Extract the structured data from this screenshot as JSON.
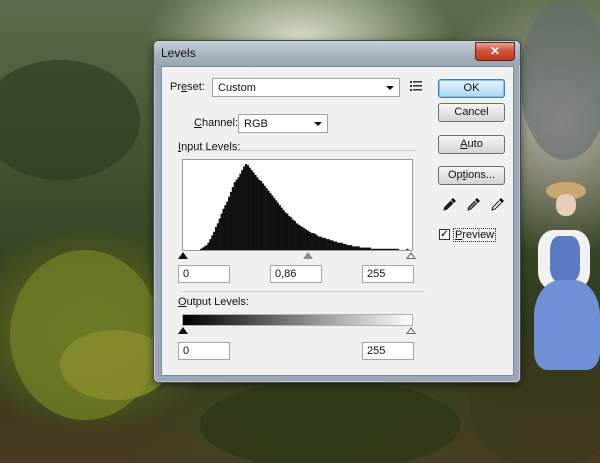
{
  "dialog": {
    "title": "Levels",
    "close_glyph": "✕",
    "preset": {
      "label_pre": "Pr",
      "label_u": "e",
      "label_post": "set:",
      "value": "Custom"
    },
    "channel": {
      "label_u": "C",
      "label_post": "hannel:",
      "value": "RGB"
    },
    "input_levels": {
      "label_u": "I",
      "label_post": "nput Levels:",
      "black": "0",
      "mid": "0,86",
      "white": "255"
    },
    "output_levels": {
      "label_u": "O",
      "label_post": "utput Levels:",
      "black": "0",
      "white": "255"
    },
    "buttons": {
      "ok": "OK",
      "cancel": "Cancel",
      "auto_u": "A",
      "auto_post": "uto",
      "options_pre": "Op",
      "options_u": "t",
      "options_post": "ions..."
    },
    "preview": {
      "label_u": "P",
      "label_post": "review",
      "checked": true,
      "check_glyph": "✓"
    }
  },
  "histogram": {
    "values": [
      0,
      0,
      0,
      0,
      0,
      0,
      0,
      0,
      0,
      1,
      2,
      3,
      4,
      6,
      9,
      12,
      15,
      19,
      22,
      26,
      30,
      34,
      37,
      40,
      44,
      48,
      52,
      56,
      58,
      60,
      63,
      66,
      69,
      71,
      70,
      68,
      66,
      64,
      62,
      60,
      58,
      57,
      55,
      53,
      51,
      49,
      47,
      45,
      43,
      41,
      39,
      37,
      35,
      33,
      31,
      30,
      28,
      27,
      25,
      24,
      22,
      21,
      20,
      19,
      18,
      17,
      16,
      15,
      14,
      14,
      13,
      12,
      11,
      11,
      10,
      10,
      9,
      9,
      8,
      8,
      7,
      7,
      6,
      6,
      6,
      5,
      5,
      4,
      4,
      4,
      3,
      3,
      3,
      3,
      2,
      2,
      2,
      2,
      2,
      2,
      1,
      1,
      1,
      1,
      1,
      1,
      1,
      1,
      1,
      1,
      1,
      1,
      1,
      1,
      1,
      0,
      0,
      0,
      0,
      1,
      0,
      0
    ]
  }
}
